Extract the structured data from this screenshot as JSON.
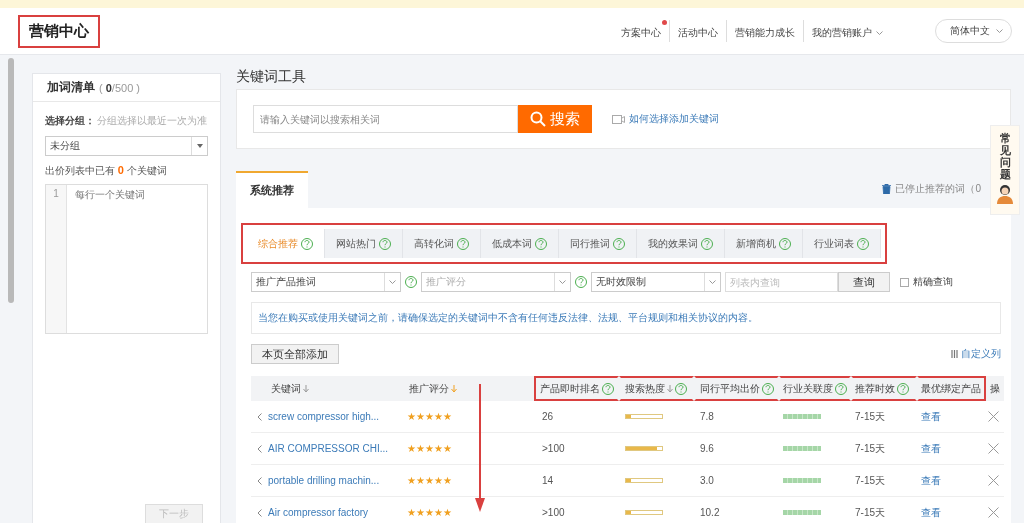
{
  "header": {
    "title": "营销中心",
    "title_highlighted": true,
    "nav": [
      {
        "label": "方案中心",
        "badge": true,
        "dropdown": false
      },
      {
        "label": "活动中心",
        "badge": false,
        "dropdown": false
      },
      {
        "label": "营销能力成长",
        "badge": false,
        "dropdown": false
      },
      {
        "label": "我的营销账户",
        "badge": false,
        "dropdown": true
      }
    ],
    "language": "简体中文"
  },
  "word_list": {
    "title": "加词清单",
    "count": "( **0**/500 )",
    "group_label": "选择分组：",
    "group_hint": "分组选择以最近一次为准",
    "group_select": "未分组",
    "existing_note": "出价列表中已有 **0** 个关键词",
    "editor_line": "1",
    "editor_placeholder": "每行一个关键词",
    "next_button": {
      "label": "下一步",
      "disabled": true
    }
  },
  "keyword_tool": {
    "title": "关键词工具",
    "search_placeholder": "请输入关键词以搜索相关词",
    "search_button": "搜索",
    "help_link": "如何选择添加关键词"
  },
  "section_tabs": [
    {
      "label": "系统推荐",
      "selected": true
    }
  ],
  "stopped_link": "已停止推荐的词（0",
  "categories_highlighted": true,
  "categories": [
    {
      "label": "综合推荐",
      "selected": true
    },
    {
      "label": "网站热门",
      "selected": false
    },
    {
      "label": "高转化词",
      "selected": false
    },
    {
      "label": "低成本词",
      "selected": false
    },
    {
      "label": "同行推词",
      "selected": false
    },
    {
      "label": "我的效果词",
      "selected": false
    },
    {
      "label": "新增商机",
      "selected": false
    },
    {
      "label": "行业词表",
      "selected": false
    }
  ],
  "filters": {
    "product_select": "推广产品推词",
    "score_placeholder": "推广评分",
    "time_select": "无时效限制",
    "query_placeholder": "列表内查询",
    "query_button": "查询",
    "exact_match": {
      "label": "精确查询",
      "checked": false
    }
  },
  "notice": "当您在购买或使用关键词之前，请确保选定的关键词中不含有任何违反法律、法规、平台规则和相关协议的内容。",
  "add_all_button": "本页全部添加",
  "custom_columns": "自定义列",
  "annotation_arrow": true,
  "table": {
    "columns": [
      {
        "label": "关键词",
        "sort_arrow": true,
        "sort_active": false,
        "help": false,
        "highlighted": false
      },
      {
        "label": "推广评分",
        "sort_arrow": true,
        "sort_active": true,
        "help": false,
        "highlighted": false
      },
      {
        "label": "产品即时排名",
        "sort_arrow": false,
        "help": true,
        "highlighted": true
      },
      {
        "label": "搜索热度",
        "sort_arrow": true,
        "sort_active": false,
        "help": true,
        "highlighted": true
      },
      {
        "label": "同行平均出价",
        "sort_arrow": false,
        "help": true,
        "highlighted": true
      },
      {
        "label": "行业关联度",
        "sort_arrow": false,
        "help": true,
        "highlighted": true
      },
      {
        "label": "推荐时效",
        "sort_arrow": false,
        "help": true,
        "highlighted": true
      },
      {
        "label": "最优绑定产品",
        "sort_arrow": false,
        "help": false,
        "highlighted": true
      },
      {
        "label": "操",
        "help": false,
        "highlighted": false
      }
    ],
    "rows": [
      {
        "keyword": "screw compressor high...",
        "stars": 5,
        "rank": "26",
        "heat": {
          "level": 0.15
        },
        "avg_bid": "7.8",
        "relevance": {
          "level": 1
        },
        "timeliness": "7-15天",
        "product": "查看"
      },
      {
        "keyword": "AIR COMPRESSOR CHI...",
        "stars": 5,
        "rank": ">100",
        "heat": {
          "level": 0.85
        },
        "avg_bid": "9.6",
        "relevance": {
          "level": 1
        },
        "timeliness": "7-15天",
        "product": "查看"
      },
      {
        "keyword": "portable drilling machin...",
        "stars": 5,
        "rank": "14",
        "heat": {
          "level": 0.15
        },
        "avg_bid": "3.0",
        "relevance": {
          "level": 1
        },
        "timeliness": "7-15天",
        "product": "查看"
      },
      {
        "keyword": "Air compressor factory",
        "stars": 5,
        "rank": ">100",
        "heat": {
          "level": 0.15
        },
        "avg_bid": "10.2",
        "relevance": {
          "level": 1
        },
        "timeliness": "7-15天",
        "product": "查看"
      }
    ]
  },
  "help_float": {
    "label": "常见问题"
  }
}
